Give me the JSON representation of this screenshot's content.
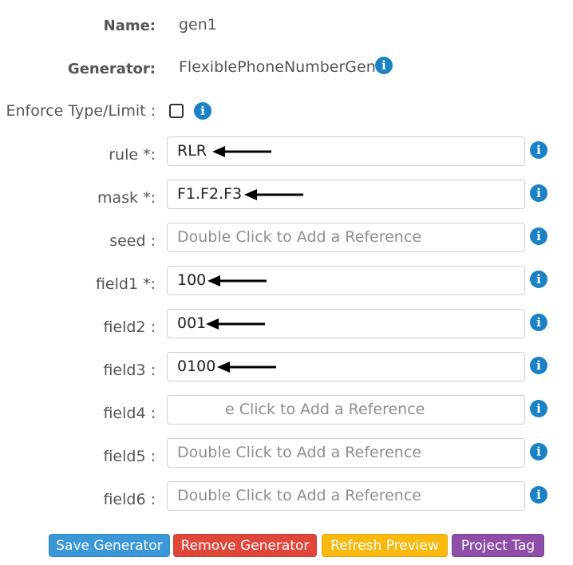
{
  "generator_info": {
    "name_label": "Name:",
    "name_value": "gen1",
    "generator_label": "Generator:",
    "generator_value": "FlexiblePhoneNumberGen",
    "enforce_label": "Enforce Type/Limit :",
    "enforce_checked": false
  },
  "fields": [
    {
      "label": "rule *:",
      "value": "RLR",
      "placeholder": ""
    },
    {
      "label": "mask *:",
      "value": "F1.F2.F3",
      "placeholder": ""
    },
    {
      "label": "seed :",
      "value": "",
      "placeholder": "Double Click to Add a Reference"
    },
    {
      "label": "field1 *:",
      "value": "100",
      "placeholder": ""
    },
    {
      "label": "field2 :",
      "value": "001",
      "placeholder": ""
    },
    {
      "label": "field3 :",
      "value": "0100",
      "placeholder": ""
    },
    {
      "label": "field4 :",
      "value": "",
      "placeholder": "e Click to Add a Reference"
    },
    {
      "label": "field5 :",
      "value": "",
      "placeholder": "Double Click to Add a Reference"
    },
    {
      "label": "field6 :",
      "value": "",
      "placeholder": "Double Click to Add a Reference"
    }
  ],
  "info_icon_glyph": "i",
  "buttons": {
    "save": "Save Generator",
    "remove": "Remove Generator",
    "refresh": "Refresh Preview",
    "project_tag": "Project Tag"
  },
  "colors": {
    "info": "#1a82c4",
    "save": "#3a98d8",
    "remove": "#e0473a",
    "refresh": "#f9b90f",
    "project_tag": "#8e4ea8"
  }
}
